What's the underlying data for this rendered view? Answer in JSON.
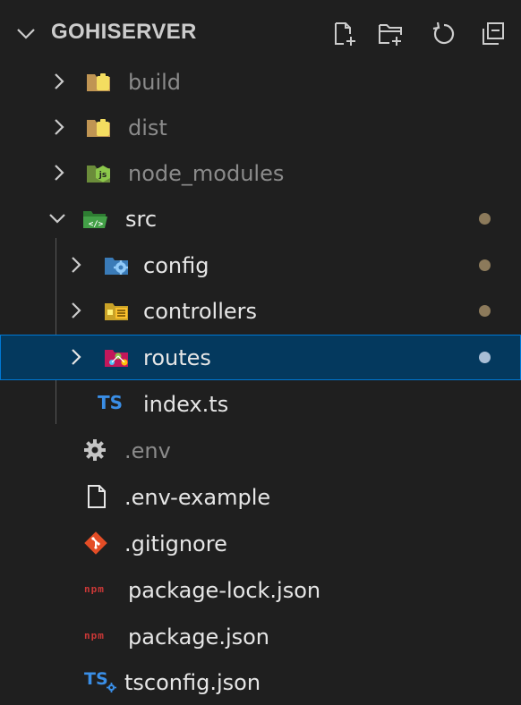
{
  "explorer": {
    "title": "GOHISERVER",
    "actions": [
      "new-file-icon",
      "new-folder-icon",
      "refresh-icon",
      "collapse-all-icon"
    ]
  },
  "tree": [
    {
      "name": "build",
      "type": "folder",
      "expanded": false,
      "ignored": true
    },
    {
      "name": "dist",
      "type": "folder",
      "expanded": false,
      "ignored": true
    },
    {
      "name": "node_modules",
      "type": "folder",
      "expanded": false,
      "ignored": true
    },
    {
      "name": "src",
      "type": "folder",
      "expanded": true,
      "modified": true
    },
    {
      "name": "config",
      "type": "folder",
      "expanded": false,
      "modified": true
    },
    {
      "name": "controllers",
      "type": "folder",
      "expanded": false,
      "modified": true
    },
    {
      "name": "routes",
      "type": "folder",
      "expanded": false,
      "modified": true,
      "selected": true
    },
    {
      "name": "index.ts",
      "type": "file",
      "icon_text": "TS"
    },
    {
      "name": ".env",
      "type": "file",
      "ignored": true
    },
    {
      "name": ".env-example",
      "type": "file"
    },
    {
      "name": ".gitignore",
      "type": "file"
    },
    {
      "name": "package-lock.json",
      "type": "file",
      "icon_text": "npm"
    },
    {
      "name": "package.json",
      "type": "file",
      "icon_text": "npm"
    },
    {
      "name": "tsconfig.json",
      "type": "file",
      "icon_text": "TS"
    }
  ],
  "colors": {
    "background": "#1f1f1f",
    "selection": "#04395e",
    "selection_border": "#0078d4",
    "modified_dot": "#8c7a5b",
    "typescript": "#3178c6",
    "npm": "#cb3837",
    "git": "#e44d26"
  }
}
